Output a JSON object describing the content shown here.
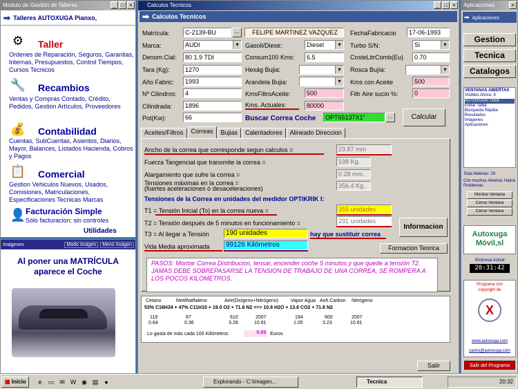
{
  "left_window": {
    "title": "Módulo de Gestión de Talleres",
    "header": "Talleres AUTOXUGA Pianxo,",
    "sections": [
      {
        "title": "Taller",
        "text": "Ordenes de Reparación, Seguros, Garantias, Internas, Presupuestos, Control Tiempos, Cursos Tecnicos"
      },
      {
        "title": "Recambios",
        "text": "Ventas y Compras Contado, Crédito, Pedidos, Gestion Artículos, Proveedores"
      },
      {
        "title": "Contabilidad",
        "text": "Cuentas, SubCuentas, Asientos, Diarios, Mayor, Balances, Listados Hacienda, Cobros y Pagos"
      },
      {
        "title": "Comercial",
        "text": "Gestion Vehiculos Nuevos, Usados, Comisiones, Matriculaciones, Especificaciones Tecnicas Marcas"
      },
      {
        "title": "Facturación Simple",
        "text": "Sólo facturacion; sin controles"
      }
    ],
    "utilidades": "Utilidades"
  },
  "images_window": {
    "title": "Imágenes",
    "mode_label": "Modo Imágen",
    "menu_label": "Menú Imágen",
    "caption": "Al poner una MATRÍCULA aparece el Coche"
  },
  "main_window": {
    "title": "Calculos Tecnicos",
    "subtitle": "Calculos Tecnicos",
    "fields": {
      "matricula_label": "Matrícula:",
      "matricula": "C-2139-BU",
      "marca_label": "Marca:",
      "marca": "AUDI",
      "denom_label": "Denom.Cial:",
      "denom": "80 1.9 TDI",
      "tara_label": "Tara (Kg):",
      "tara": "1270",
      "anio_label": "Año Fabric:",
      "anio": "1993",
      "cilindros_label": "Nº Cilindros:",
      "cilindros": "4",
      "cilindrada_label": "Cilindrada:",
      "cilindrada": "1896",
      "potkw_label": "Pot(Kw):",
      "potkw": "66",
      "cliente": "FELIPE MARTINEZ VAZQUEZ",
      "gasoli_label": "Gasoli/Diese:",
      "gasoli": "Diesel",
      "consum_label": "Consum100 Kms:",
      "consum": "6.5",
      "hexag_label": "Hexág Bujia:",
      "arandela_label": "Arandela Bujia:",
      "kmsfiltro_label": "KmsFiltroAceite:",
      "kmsfiltro": "500",
      "kmsact_label": "Kms. Actuales:",
      "kmsact": "80000",
      "fecha_label": "FechaFabricacio",
      "fecha": "17-06-1993",
      "turbo_label": "Turbo S/N:",
      "turbo": "Si",
      "coste_label": "CosteLitrComb(Eu)",
      "coste": "0.70",
      "rosca_label": "Rosca Bujía:",
      "kmsaceite_label": "Kms con Aceite",
      "kmsaceite": "500",
      "filtro_label": "Filtr Aire sucio %:",
      "filtro": "0"
    },
    "buscar_label": "Buscar Correa Coche",
    "buscar_value": "OPT65137X1\"",
    "calcular": "Calcular",
    "tabs": [
      "Aceites/Filtros",
      "Correas",
      "Bujias",
      "Calentadores",
      "Alineado Direccion"
    ],
    "correas": {
      "rows": [
        {
          "label": "Ancho de la correa que corresponde segun calculos =",
          "value": "23.87 mm"
        },
        {
          "label": "Fuerza Tangencial que transmite la correa =",
          "value": "198 Kg."
        },
        {
          "label": "Alargamiento que sufre la correa =",
          "value": "0.28 mm."
        },
        {
          "label": "Tensiones máximas en la correa =",
          "label2": "(fuertes aceleraciones ó desaceleraciones)",
          "value": "356.4 Kg."
        }
      ],
      "heading": "Tensiones de la Correa en unidades del medidor OPTIKRIK I:",
      "t1_label": "T1 = Tensión Inicial (To) en la correa nueva =",
      "t1": "355 unidades",
      "t2_label": "T2 = Tensión después de 5 minutos en funcionamiento =",
      "t2": "291 unidades",
      "t3_label": "T3 = Al llegar a Tensión",
      "t3": "190 unidades",
      "t3_tail": "hay que sustituir correa",
      "vida_label": "Vida Media aproximada",
      "vida": "99126 Kilómetros",
      "informacion": "Informacion",
      "formacion": "Formacion Teorica",
      "note": "PASOS: Montar Correa Distribucion, tensar, encender coche 5 minutos y que quede a tensión T2. JAMAS DEBE SOBREPASARSE LA TENSION DE TRABAJO DE UNA CORREA, SE ROMPERA A LOS POCOS KILOMETROS."
    },
    "chem": {
      "headers": [
        "Cetano",
        "MetilNaftaleno",
        "Aire(Oxígeno+Nitrógeno)",
        "Vapor Agua",
        "Anh.Carbon",
        "Nitrógeno"
      ],
      "formula": "53% C16H34 + 47% C11H10 + 19.0 O2 + 71.6 N2 <=> 10.8 H2O + 13.6 CO2 + 71.6 N2",
      "row1": [
        "119",
        "67",
        "610",
        "2007",
        "194",
        "600",
        "2007"
      ],
      "row2": [
        "0.64",
        "0.36",
        "3.28",
        "10.81",
        "1.05",
        "3.23",
        "10.81"
      ],
      "footer_label": "Lo gasta de más cada 100 Kilómetros",
      "footer_value": "0.03",
      "footer_unit": "Euros."
    },
    "salir": "Salir"
  },
  "right_window": {
    "title": "Aplicaciones",
    "subtitle": "Aplicaciones",
    "buttons": [
      "Gestion",
      "Tecnica",
      "Catalogos"
    ],
    "ventanas_title": "VENTANAS ABIERTAS",
    "visibles": "Visibles Ahora: 6",
    "open_list": [
      "AUTOXUGA: Gest",
      "Editar Tabla",
      "Búsqueda Rápida",
      "Resultados",
      "Imágenes",
      "Aplicaciones"
    ],
    "total": "Total Abiertas: 29",
    "problemas": "Con muchas Abiertas Habrá Problemas",
    "mostrar": "Mostrar Ventana",
    "cerrar": "Cerrar Ventana",
    "cerrar2": "Cerrar Ventana",
    "logo": "Autoxuga Móvil,sl",
    "empresa": "Empresa Actual:",
    "clock": "20:31:42",
    "programa": "Programa con copyright de",
    "web": "www.autoxuga.com",
    "email": "castro@autoxuga.com",
    "salir": "Salir del Programa"
  },
  "taskbar": {
    "start": "Inicio",
    "tasks": [
      "Explorando - C:\\Imagen...",
      "Tecnica"
    ],
    "time": "20:32"
  }
}
